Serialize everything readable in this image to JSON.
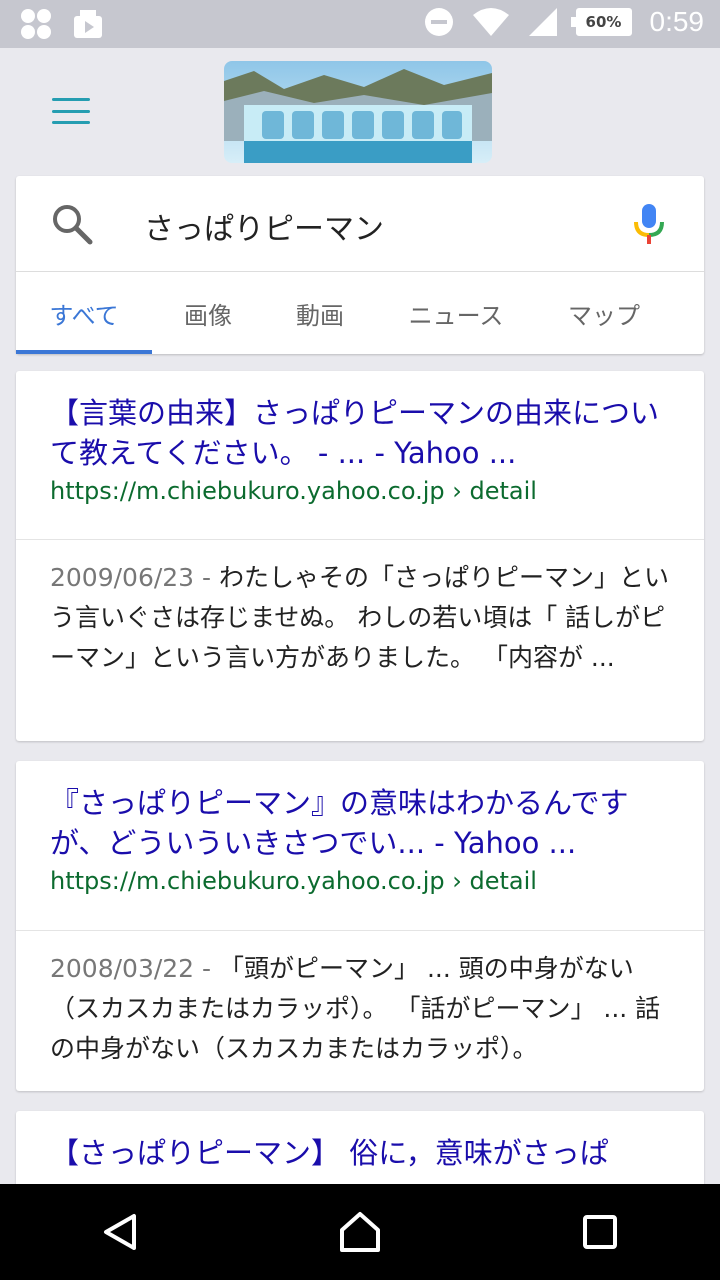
{
  "status_bar": {
    "battery": "60%",
    "time": "0:59",
    "icons": [
      "app-icon",
      "media-icon",
      "do-not-disturb-icon",
      "wifi-icon",
      "signal-icon",
      "battery-icon"
    ]
  },
  "search": {
    "query": "さっぱりピーマン"
  },
  "tabs": [
    {
      "label": "すべて",
      "active": true
    },
    {
      "label": "画像",
      "active": false
    },
    {
      "label": "動画",
      "active": false
    },
    {
      "label": "ニュース",
      "active": false
    },
    {
      "label": "マップ",
      "active": false
    }
  ],
  "results": [
    {
      "title": "【言葉の由来】さっぱりピーマンの由来について教えてください。 - ... - Yahoo ...",
      "url": "https://m.chiebukuro.yahoo.co.jp › detail",
      "date": "2009/06/23 - ",
      "snippet": "わたしゃその「さっぱりピーマン」という言いぐさは存じませぬ。 わしの若い頃は「 話しがピーマン」という言い方がありました。 「内容が ..."
    },
    {
      "title": "『さっぱりピーマン』の意味はわかるんですが、どういういきさつでい... - Yahoo ...",
      "url": "https://m.chiebukuro.yahoo.co.jp › detail",
      "date": "2008/03/22 - ",
      "snippet": "「頭がピーマン」 ... 頭の中身がない（スカスカまたはカラッポ）。 「話がピーマン」 ... 話の中身がない（スカスカまたはカラッポ）。"
    },
    {
      "title": "【さっぱりピーマン】 俗に，意味がさっぱ"
    }
  ],
  "colors": {
    "accent": "#3b77d6",
    "link": "#1a0dab",
    "url": "#0c6b2f",
    "menu": "#259db1"
  }
}
